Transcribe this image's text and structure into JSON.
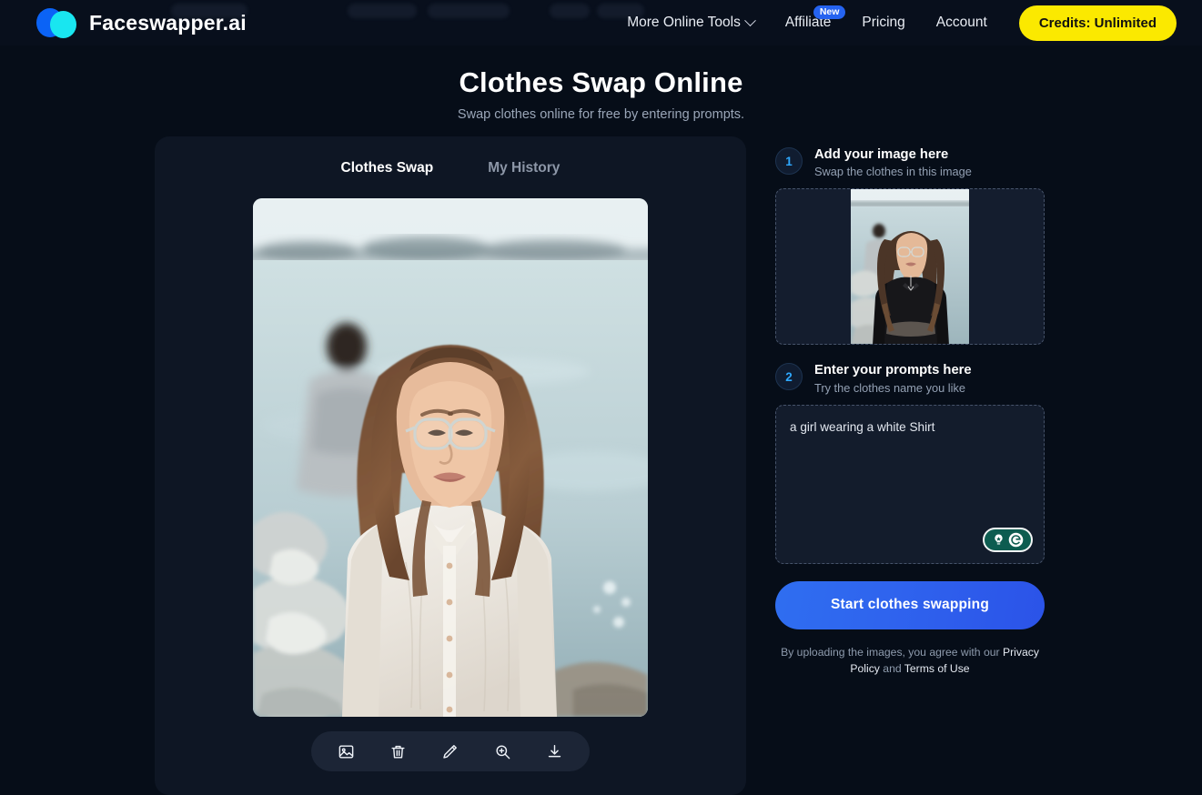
{
  "header": {
    "brand_name": "Faceswapper.ai",
    "brand_icon": "two-overlapping-circles-logo",
    "nav": [
      {
        "label": "More Online Tools",
        "icon": "chevron-down-icon",
        "badge": null
      },
      {
        "label": "Affiliate",
        "icon": null,
        "badge": "New"
      },
      {
        "label": "Pricing",
        "icon": null,
        "badge": null
      },
      {
        "label": "Account",
        "icon": null,
        "badge": null
      }
    ],
    "credits_label": "Credits: Unlimited",
    "credits_color": "#fbe900"
  },
  "page": {
    "title": "Clothes Swap Online",
    "subtitle": "Swap clothes online for free by entering prompts."
  },
  "tabs": [
    {
      "label": "Clothes Swap",
      "active": true
    },
    {
      "label": "My History",
      "active": false
    }
  ],
  "preview": {
    "alt": "woman with glasses in white button-up shirt standing by the water",
    "toolbar": [
      {
        "name": "image-icon",
        "title": "Replace image"
      },
      {
        "name": "trash-icon",
        "title": "Delete"
      },
      {
        "name": "pencil-icon",
        "title": "Edit"
      },
      {
        "name": "zoom-in-icon",
        "title": "Zoom in"
      },
      {
        "name": "download-icon",
        "title": "Download"
      }
    ]
  },
  "steps": [
    {
      "number": "1",
      "title": "Add your image here",
      "desc": "Swap the clothes in this image",
      "thumb_alt": "woman in black top standing by the water"
    },
    {
      "number": "2",
      "title": "Enter your prompts here",
      "desc": "Try the clothes name you like"
    }
  ],
  "prompt": {
    "value": "a girl wearing a white Shirt",
    "placeholder": "Try the clothes name you like",
    "assistant_icons": [
      "lightbulb-icon",
      "grammarly-g-icon"
    ],
    "assistant_color": "#0d5c50"
  },
  "action": {
    "start_label": "Start clothes swapping",
    "accent_color": "#2f6ef0"
  },
  "legal": {
    "prefix": "By uploading the images, you agree with our ",
    "privacy": "Privacy Policy",
    "middle": " and ",
    "terms": "Terms of Use"
  }
}
